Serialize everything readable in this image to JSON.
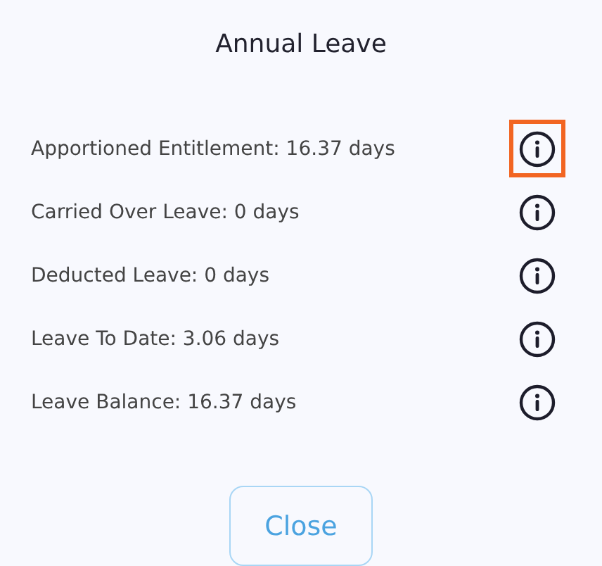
{
  "title": "Annual Leave",
  "items": [
    {
      "label": "Apportioned Entitlement: 16.37 days",
      "highlighted": true
    },
    {
      "label": "Carried Over Leave: 0 days",
      "highlighted": false
    },
    {
      "label": "Deducted Leave: 0 days",
      "highlighted": false
    },
    {
      "label": "Leave To Date: 3.06 days",
      "highlighted": false
    },
    {
      "label": "Leave Balance: 16.37 days",
      "highlighted": false
    }
  ],
  "close_button": "Close"
}
